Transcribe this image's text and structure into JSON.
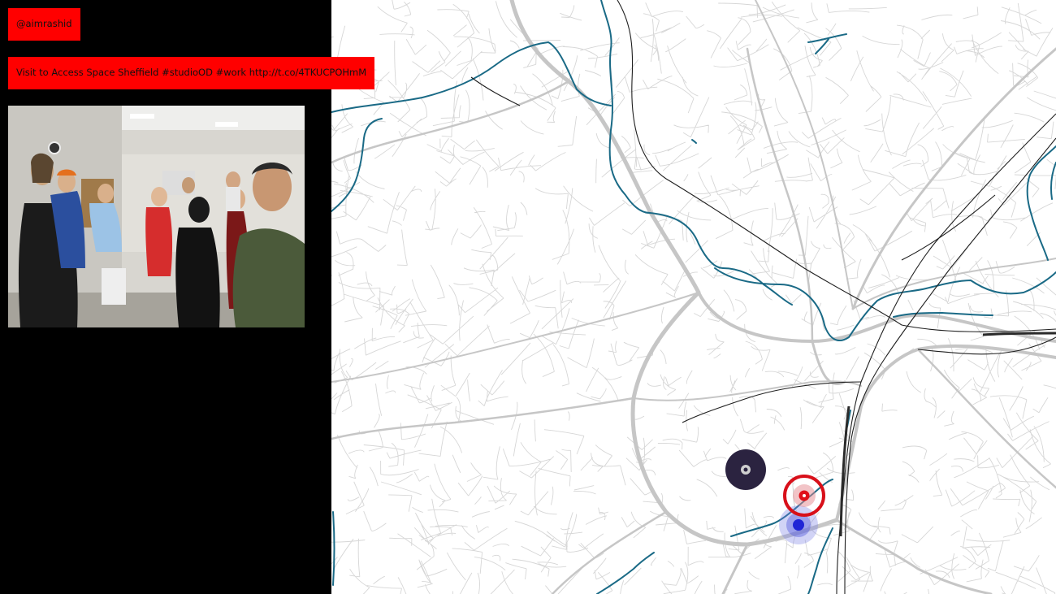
{
  "sidebar": {
    "handle": "@aimrashid",
    "tweet_text": "Visit  to Access Space Sheffield #studioOD #work http://t.co/4TKUCPOHmM"
  },
  "photo": {
    "subject": "group of people standing in an office room"
  },
  "map": {
    "city": "Sheffield",
    "style": "line-drawing street map",
    "colors": {
      "background": "#000000",
      "map_background": "#ffffff",
      "roads": "#c8c8c8",
      "rivers": "#1a6a86",
      "railways": "#1f1f1f",
      "highlight_box": "#ff0000"
    },
    "markers": [
      {
        "name": "dark-marker",
        "color": "#2b2340"
      },
      {
        "name": "red-marker",
        "color": "#e0101a"
      },
      {
        "name": "blue-marker",
        "color": "#1f24d6"
      }
    ]
  }
}
